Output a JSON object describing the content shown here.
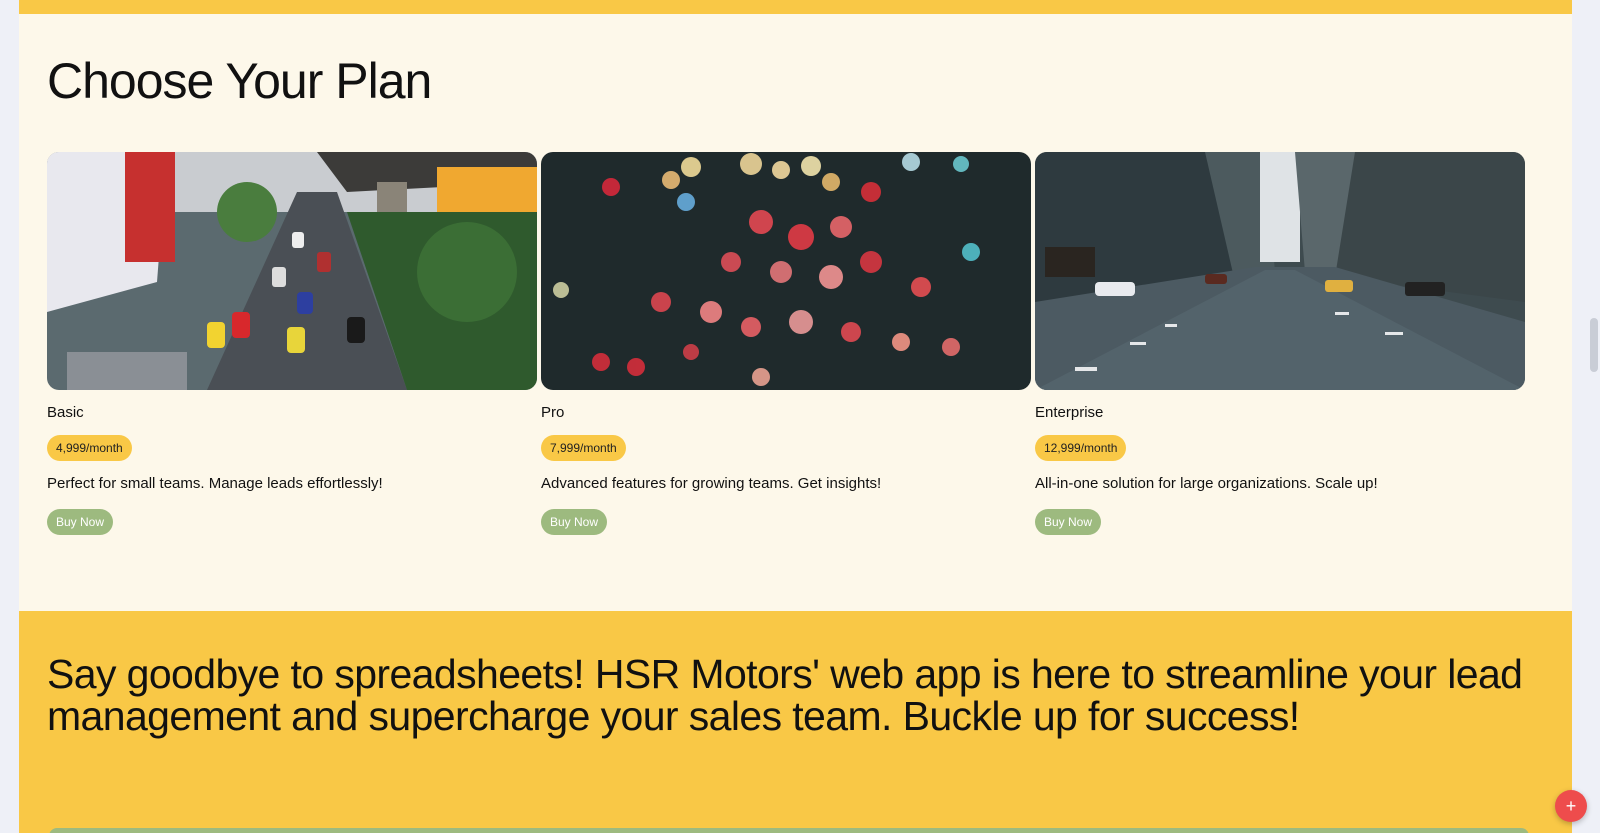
{
  "plans": {
    "title": "Choose Your Plan",
    "items": [
      {
        "name": "Basic",
        "price": "4,999/month",
        "description": "Perfect for small teams. Manage leads effortlessly!",
        "button": "Buy Now",
        "image_icon": "city-traffic-image"
      },
      {
        "name": "Pro",
        "price": "7,999/month",
        "description": "Advanced features for growing teams. Get insights!",
        "button": "Buy Now",
        "image_icon": "bokeh-lights-image"
      },
      {
        "name": "Enterprise",
        "price": "12,999/month",
        "description": "All-in-one solution for large organizations. Scale up!",
        "button": "Buy Now",
        "image_icon": "city-street-image"
      }
    ]
  },
  "banner": {
    "text": "Say goodbye to spreadsheets! HSR Motors' web app is here to streamline your lead management and supercharge your sales team. Buckle up for success!"
  },
  "fab": {
    "icon": "plus-icon",
    "label": "+"
  },
  "colors": {
    "accent_yellow": "#f9c846",
    "button_green": "#9dba7f",
    "page_background": "#fdf8ea",
    "fab_red": "#ee4c4c"
  }
}
